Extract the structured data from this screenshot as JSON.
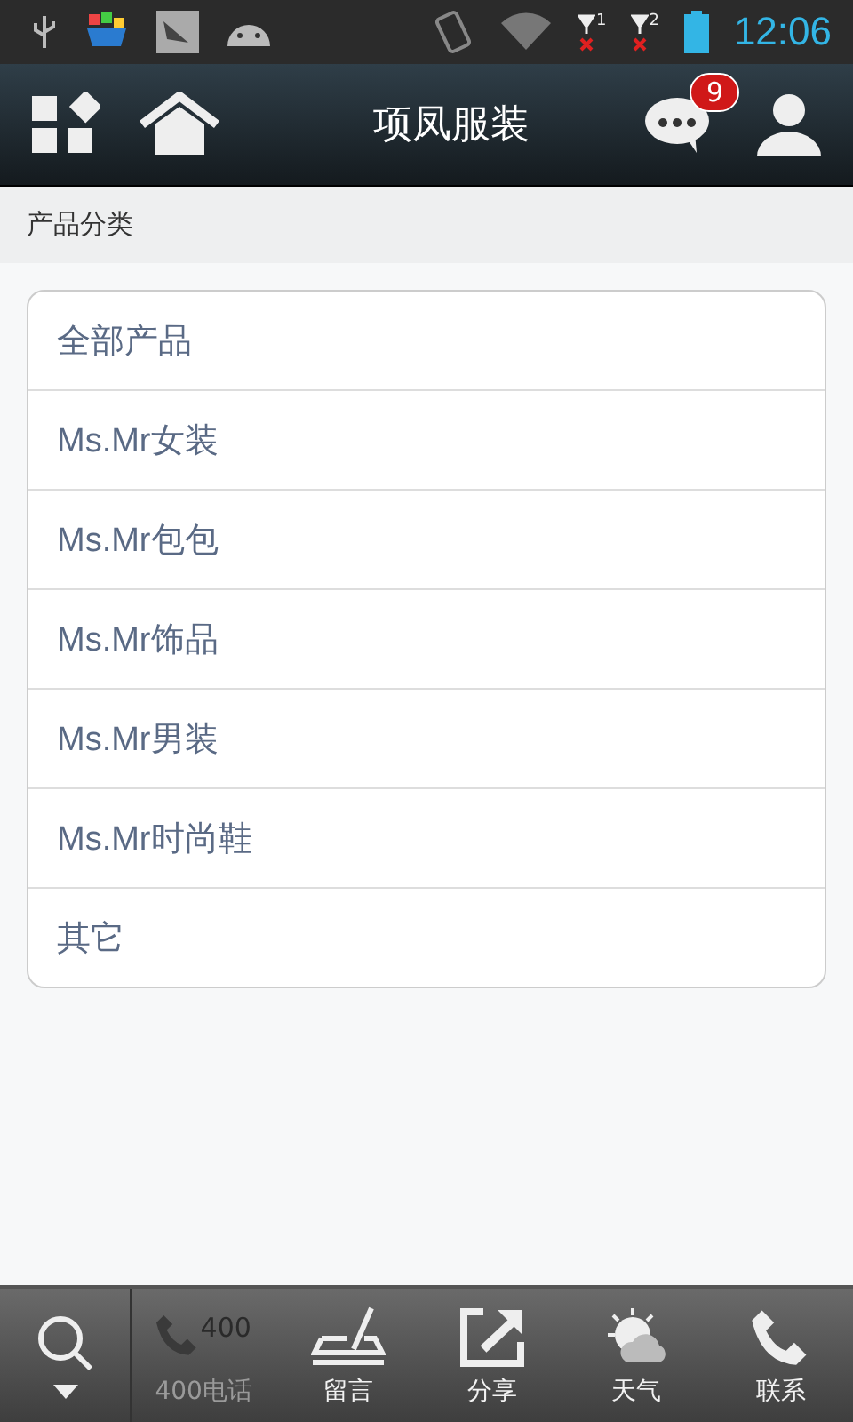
{
  "status_bar": {
    "time": "12:06",
    "sim_labels": [
      "1",
      "2"
    ]
  },
  "header": {
    "title": "项凤服装",
    "badge": "9"
  },
  "section": {
    "title": "产品分类"
  },
  "categories": [
    {
      "label": "全部产品"
    },
    {
      "label": "Ms.Mr女装"
    },
    {
      "label": "Ms.Mr包包"
    },
    {
      "label": "Ms.Mr饰品"
    },
    {
      "label": "Ms.Mr男装"
    },
    {
      "label": "Ms.Mr时尚鞋"
    },
    {
      "label": "其它"
    }
  ],
  "bottom_bar": [
    {
      "kind": "phone400",
      "icon_text": "400",
      "label": "400电话",
      "disabled": true
    },
    {
      "kind": "message",
      "label": "留言",
      "disabled": false
    },
    {
      "kind": "share",
      "label": "分享",
      "disabled": false
    },
    {
      "kind": "weather",
      "label": "天气",
      "disabled": false
    },
    {
      "kind": "phone",
      "label": "联系",
      "disabled": false
    }
  ]
}
